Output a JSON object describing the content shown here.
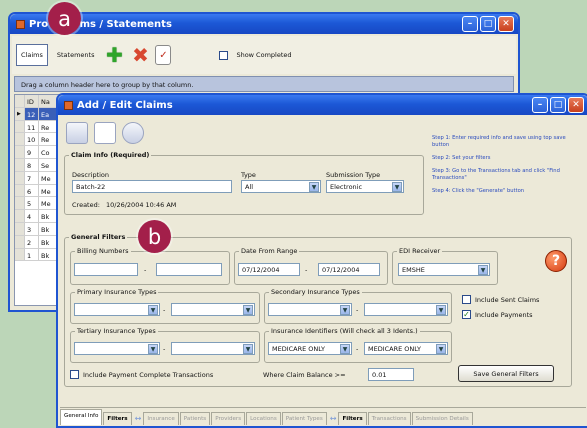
{
  "badges": {
    "a": "a",
    "b": "b"
  },
  "back_window": {
    "title": "Pro",
    "title_tail": "ims / Statements",
    "tabs": [
      "Claims",
      "Statements"
    ],
    "show_completed": "Show Completed",
    "drag_hint": "Drag a column header here to group by that column.",
    "grid_header": [
      "ID",
      "Na"
    ],
    "rows": [
      {
        "id": "12",
        "name": "Ea"
      },
      {
        "id": "11",
        "name": "Re"
      },
      {
        "id": "10",
        "name": "Re"
      },
      {
        "id": "9",
        "name": "Co"
      },
      {
        "id": "8",
        "name": "Se"
      },
      {
        "id": "7",
        "name": "Me"
      },
      {
        "id": "6",
        "name": "Me"
      },
      {
        "id": "5",
        "name": "Me"
      },
      {
        "id": "4",
        "name": "Bk"
      },
      {
        "id": "3",
        "name": "Bk"
      },
      {
        "id": "2",
        "name": "Bk"
      },
      {
        "id": "1",
        "name": "Bk"
      }
    ]
  },
  "front_window": {
    "title": "Add / Edit Claims",
    "claim_info": {
      "legend": "Claim Info  (Required)",
      "description_label": "Description",
      "description_value": "Batch-22",
      "type_label": "Type",
      "type_value": "All",
      "submission_label": "Submission Type",
      "submission_value": "Electronic",
      "created_label": "Created:",
      "created_value": "10/26/2004 10:46 AM"
    },
    "steps": [
      "Step 1: Enter required info and save using top save button",
      "Step 2: Set your filters",
      "Step 3: Go to the Transactions tab and click \"Find Transactions\"",
      "Step 4: Click the \"Generate\" button"
    ],
    "general_filters": {
      "legend": "General Filters",
      "billing_numbers": "Billing Numbers",
      "date_from_range": "Date From Range",
      "date_from": "07/12/2004",
      "date_to": "07/12/2004",
      "edi_receiver": "EDI Receiver",
      "edi_value": "EMSHE",
      "primary": "Primary Insurance Types",
      "secondary": "Secondary Insurance Types",
      "tertiary": "Tertiary Insurance Types",
      "identifiers": "Insurance Identifiers (Will check all 3 Idents.)",
      "ident1": "MEDICARE ONLY",
      "ident2": "MEDICARE ONLY",
      "include_sent": "Include Sent Claims",
      "include_payments": "Include Payments",
      "include_complete": "Include Payment Complete Transactions",
      "where_balance": "Where Claim Balance >=",
      "balance_value": "0.01",
      "save_button": "Save General Filters",
      "dash": "-"
    },
    "tabs": [
      "General Info",
      "Filters",
      "Insurance",
      "Patients",
      "Providers",
      "Locations",
      "Patient Types",
      "Filters",
      "Transactions",
      "Submission Details"
    ]
  }
}
